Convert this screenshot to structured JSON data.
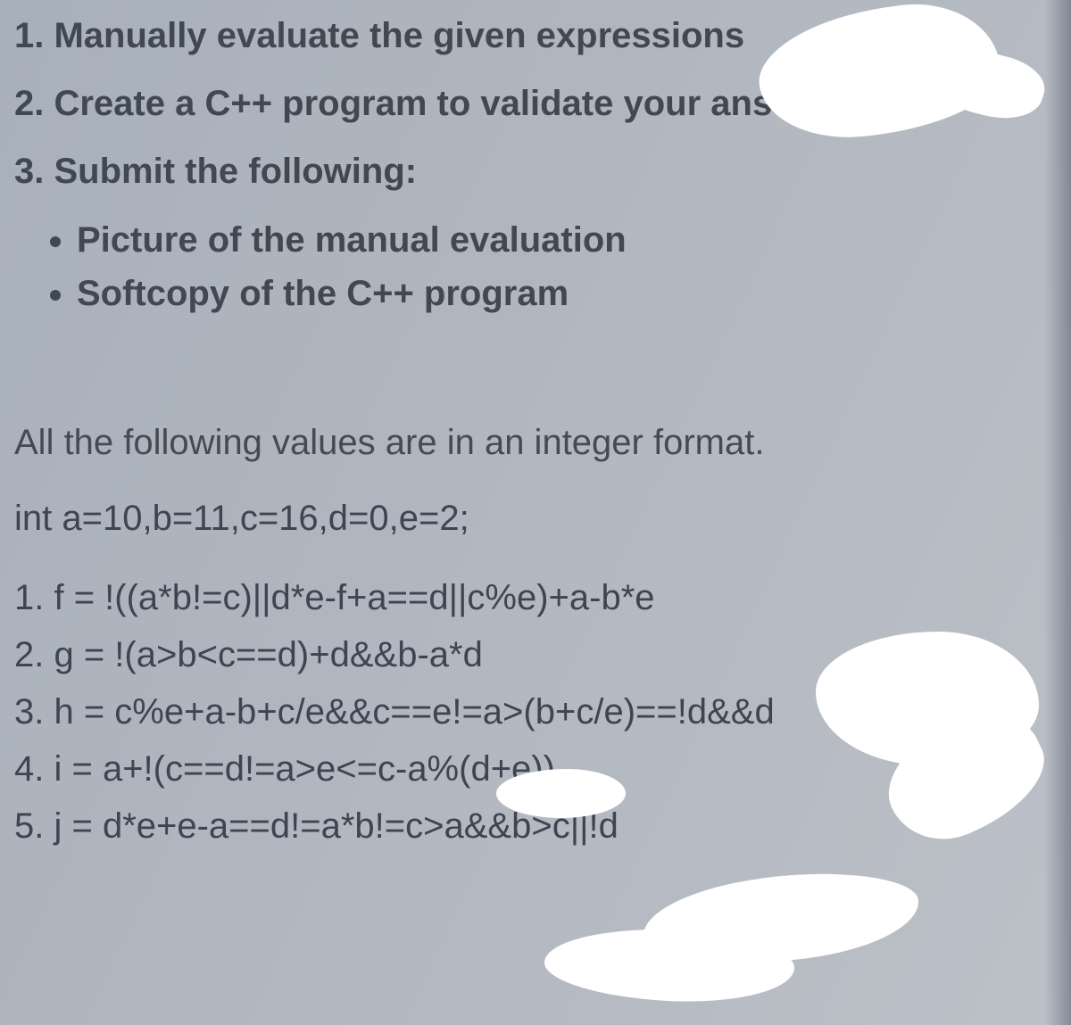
{
  "instructions": [
    "1. Manually evaluate the given expressions",
    "2. Create a C++ program to validate your answer",
    "3. Submit the following:"
  ],
  "bullets": [
    "Picture of the manual evaluation",
    "Softcopy of the C++ program"
  ],
  "note": "All the following values are in an integer format.",
  "decl": "int a=10,b=11,c=16,d=0,e=2;",
  "exprs": [
    "1. f = !((a*b!=c)||d*e-f+a==d||c%e)+a-b*e",
    "2. g = !(a>b<c==d)+d&&b-a*d",
    "3. h = c%e+a-b+c/e&&c==e!=a>(b+c/e)==!d&&d",
    "4. i = a+!(c==d!=a>e<=c-a%(d+e))",
    "5. j = d*e+e-a==d!=a*b!=c>a&&b>c||!d"
  ]
}
